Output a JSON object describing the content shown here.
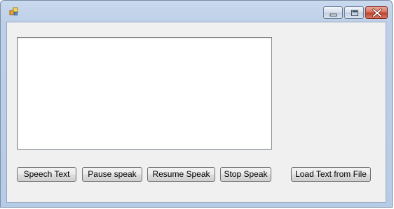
{
  "window": {
    "title": "",
    "controls": {
      "minimize": "minimize",
      "maximize": "maximize",
      "close": "close"
    }
  },
  "textbox": {
    "value": ""
  },
  "buttons": {
    "speech_text": "Speech Text",
    "pause_speak": "Pause speak",
    "resume_speak": "Resume Speak",
    "stop_speak": "Stop Speak",
    "load_text": "Load Text from File"
  },
  "colors": {
    "frame": "#bed0e8",
    "client": "#f0f0f0",
    "close_button": "#c0402a"
  }
}
